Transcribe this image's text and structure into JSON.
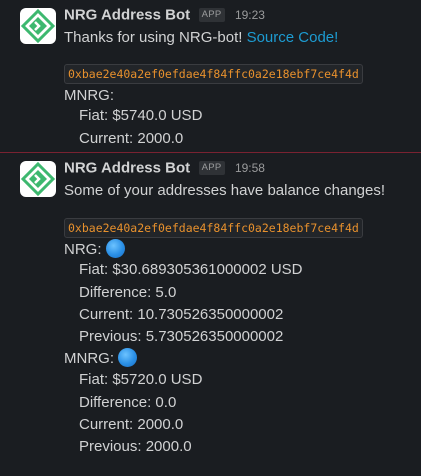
{
  "messages": [
    {
      "bot_name": "NRG Address Bot",
      "badge": "APP",
      "time": "19:23",
      "text": "Thanks for using NRG-bot!",
      "link_text": "Source Code!",
      "address": "0xbae2e40a2ef0efdae4f84ffc0a2e18ebf7ce4f4d",
      "section_label": "MNRG:",
      "fiat": "Fiat: $5740.0 USD",
      "current": "Current: 2000.0"
    },
    {
      "bot_name": "NRG Address Bot",
      "badge": "APP",
      "time": "19:58",
      "text": "Some of your addresses have balance changes!",
      "address": "0xbae2e40a2ef0efdae4f84ffc0a2e18ebf7ce4f4d",
      "sections": [
        {
          "label": "NRG:",
          "icon": "blue-circle-icon",
          "fiat": "Fiat: $30.689305361000002 USD",
          "difference": "Difference: 5.0",
          "current": "Current: 10.730526350000002",
          "previous": "Previous: 5.730526350000002"
        },
        {
          "label": "MNRG:",
          "icon": "blue-circle-icon",
          "fiat": "Fiat: $5720.0 USD",
          "difference": "Difference: 0.0",
          "current": "Current: 2000.0",
          "previous": "Previous: 2000.0"
        }
      ]
    }
  ],
  "colors": {
    "background": "#1a1d21",
    "text": "#d1d2d3",
    "link": "#1d9bd1",
    "code": "#e8912d",
    "divider": "#7a2231",
    "avatar_green": "#3db86f"
  }
}
